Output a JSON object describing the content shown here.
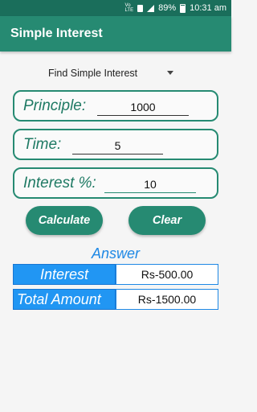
{
  "status_bar": {
    "network_label": "VoLTE",
    "battery": "89%",
    "time": "10:31 am"
  },
  "app_bar": {
    "title": "Simple Interest"
  },
  "mode_select": {
    "selected": "Find Simple Interest"
  },
  "fields": {
    "principle": {
      "label": "Principle:",
      "value": "1000"
    },
    "time": {
      "label": "Time:",
      "value": "5"
    },
    "interest": {
      "label": "Interest %:",
      "value": "10"
    }
  },
  "buttons": {
    "calculate": "Calculate",
    "clear": "Clear"
  },
  "answer": {
    "title": "Answer",
    "rows": [
      {
        "key": "Interest",
        "value": "Rs-500.00"
      },
      {
        "key": "Total Amount",
        "value": "Rs-1500.00"
      }
    ]
  },
  "colors": {
    "primary": "#268a72",
    "status_bar": "#1a6e5b",
    "answer_blue": "#2196f3"
  }
}
